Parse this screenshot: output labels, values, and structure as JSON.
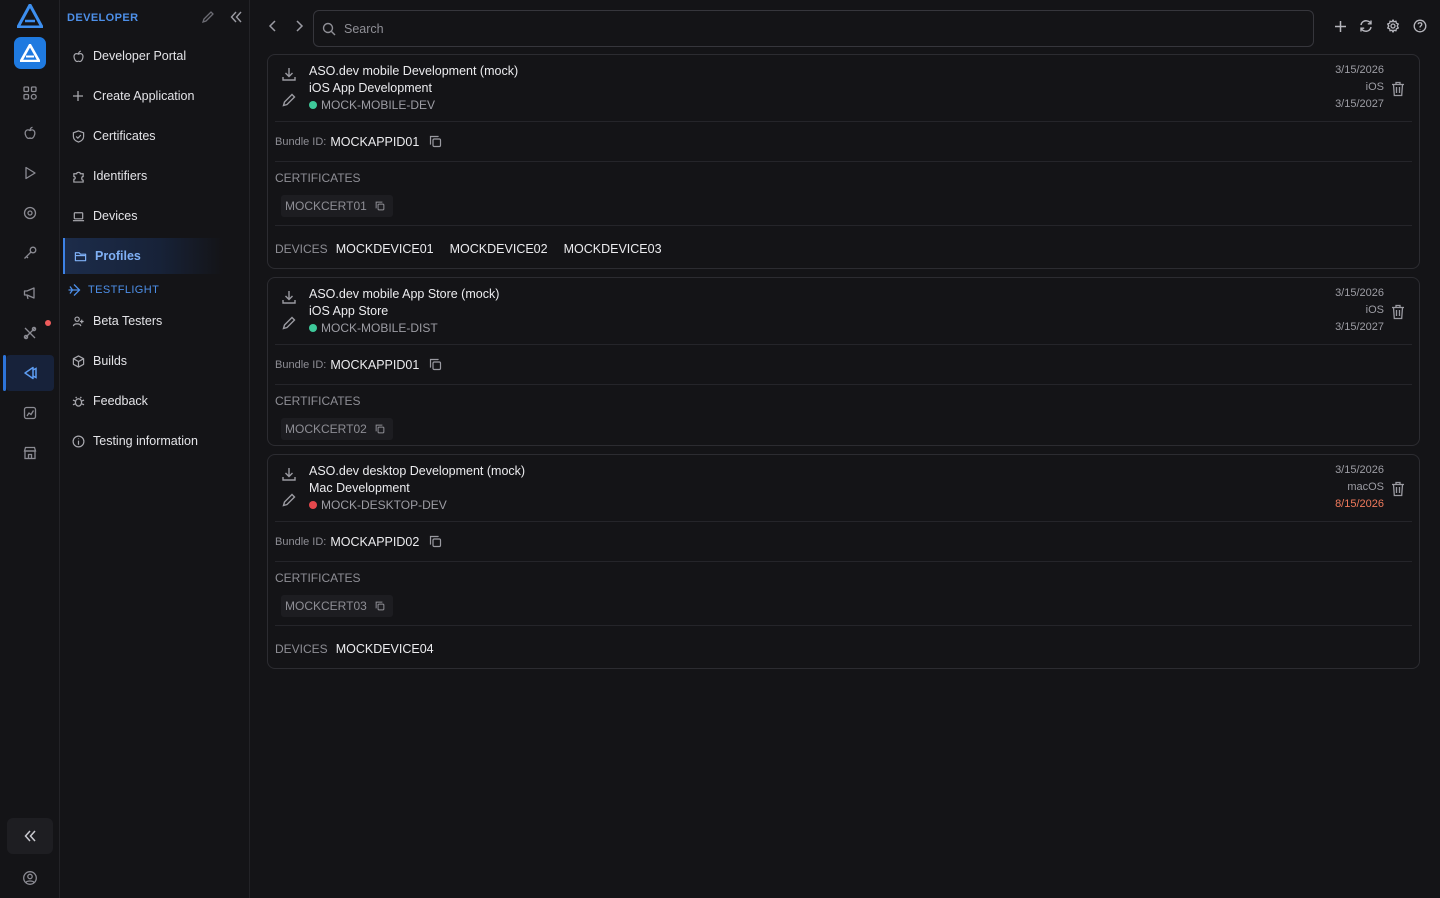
{
  "sidebar": {
    "header": "DEVELOPER",
    "items": [
      {
        "label": "Developer Portal",
        "icon": "apple-icon"
      },
      {
        "label": "Create Application",
        "icon": "plus-icon"
      },
      {
        "label": "Certificates",
        "icon": "shield-check-icon"
      },
      {
        "label": "Identifiers",
        "icon": "puzzle-icon"
      },
      {
        "label": "Devices",
        "icon": "laptop-icon"
      },
      {
        "label": "Profiles",
        "icon": "folder-icon",
        "active": true
      }
    ],
    "section": "TESTFLIGHT",
    "testflight_items": [
      {
        "label": "Beta Testers",
        "icon": "users-icon"
      },
      {
        "label": "Builds",
        "icon": "package-icon"
      },
      {
        "label": "Feedback",
        "icon": "bug-icon"
      },
      {
        "label": "Testing information",
        "icon": "info-icon"
      }
    ]
  },
  "search": {
    "placeholder": "Search"
  },
  "profiles": [
    {
      "name": "ASO.dev mobile Development (mock)",
      "type": "iOS App Development",
      "identifier": "MOCK-MOBILE-DEV",
      "status_color": "#3ec99a",
      "created": "3/15/2026",
      "platform": "iOS",
      "expires": "3/15/2027",
      "expires_color": "#9d9da4",
      "bundle_label": "Bundle ID:",
      "bundle_id": "MOCKAPPID01",
      "certificates_label": "CERTIFICATES",
      "certificates": [
        "MOCKCERT01"
      ],
      "devices_label": "DEVICES",
      "devices": [
        "MOCKDEVICE01",
        "MOCKDEVICE02",
        "MOCKDEVICE03"
      ]
    },
    {
      "name": "ASO.dev mobile App Store (mock)",
      "type": "iOS App Store",
      "identifier": "MOCK-MOBILE-DIST",
      "status_color": "#3ec99a",
      "created": "3/15/2026",
      "platform": "iOS",
      "expires": "3/15/2027",
      "expires_color": "#9d9da4",
      "bundle_label": "Bundle ID:",
      "bundle_id": "MOCKAPPID01",
      "certificates_label": "CERTIFICATES",
      "certificates": [
        "MOCKCERT02"
      ],
      "devices_label": "",
      "devices": []
    },
    {
      "name": "ASO.dev desktop Development (mock)",
      "type": "Mac Development",
      "identifier": "MOCK-DESKTOP-DEV",
      "status_color": "#e5484d",
      "created": "3/15/2026",
      "platform": "macOS",
      "expires": "8/15/2026",
      "expires_color": "#f07a5c",
      "bundle_label": "Bundle ID:",
      "bundle_id": "MOCKAPPID02",
      "certificates_label": "CERTIFICATES",
      "certificates": [
        "MOCKCERT03"
      ],
      "devices_label": "DEVICES",
      "devices": [
        "MOCKDEVICE04"
      ]
    }
  ]
}
